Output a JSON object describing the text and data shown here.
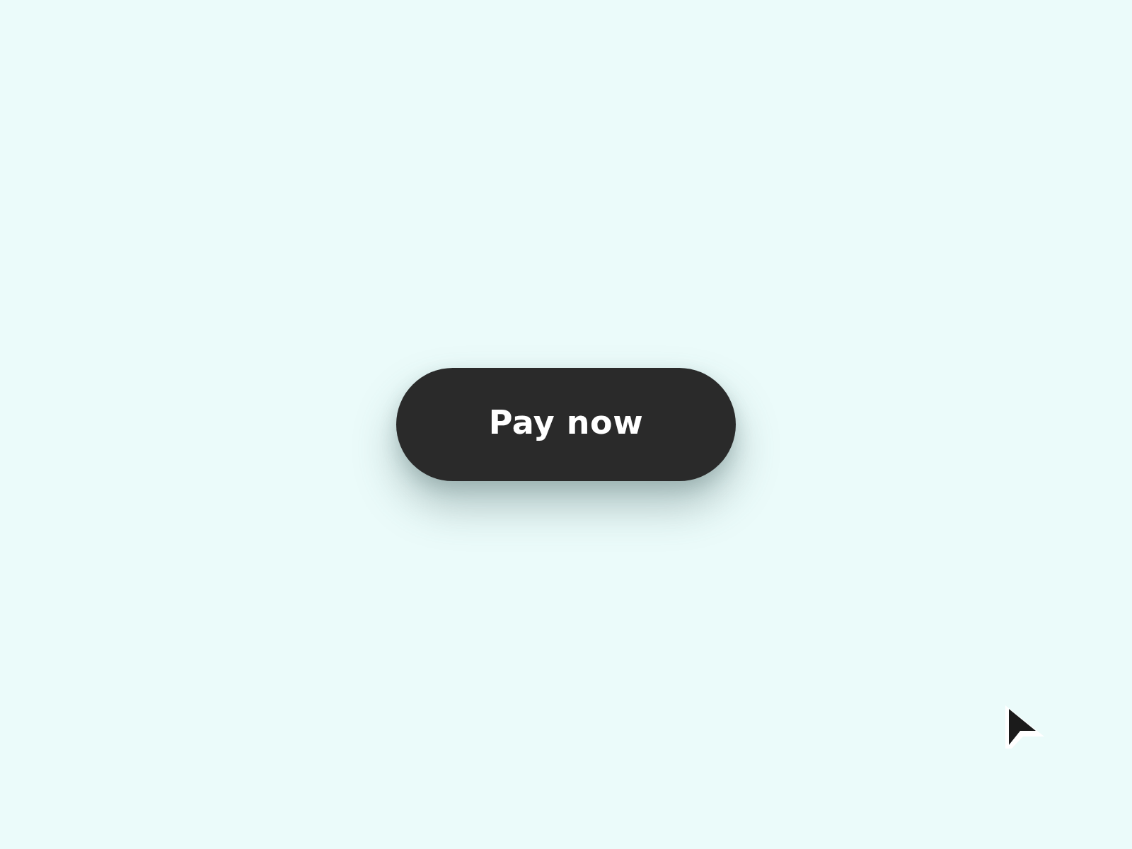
{
  "button": {
    "label": "Pay now"
  }
}
